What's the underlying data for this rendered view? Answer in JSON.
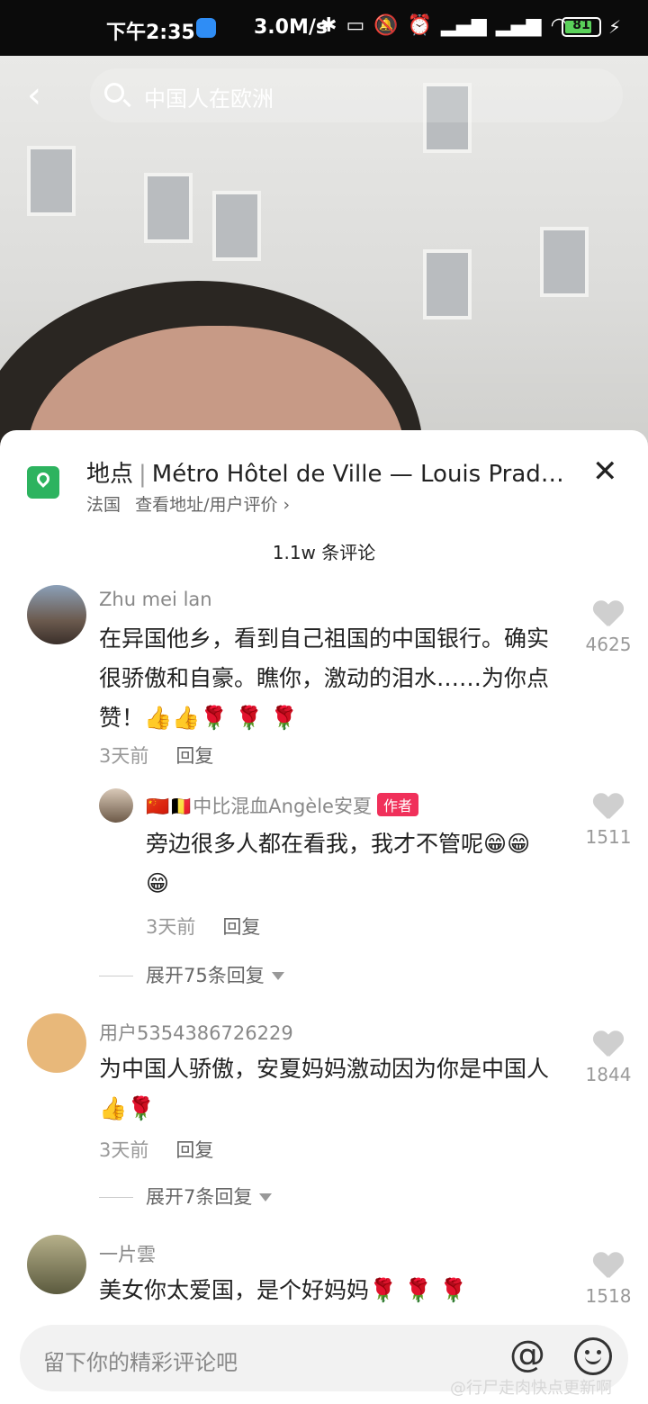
{
  "status_bar": {
    "time": "下午2:35",
    "speed": "3.0M/s",
    "battery": "81",
    "battery_level": 0.81
  },
  "search": {
    "placeholder": "中国人在欧洲"
  },
  "location": {
    "label": "地点",
    "name": "Métro Hôtel de Ville — Louis Prad…",
    "country": "法国",
    "link": "查看地址/用户评价"
  },
  "comments_header": {
    "count": "1.1w 条评论"
  },
  "comments": [
    {
      "author": "Zhu mei lan",
      "text": "在异国他乡，看到自己祖国的中国银行。确实很骄傲和自豪。瞧你，激动的泪水……为你点赞！👍👍🌹 🌹 🌹",
      "time": "3天前",
      "reply": "回复",
      "likes": "4625"
    },
    {
      "author": "🇨🇳🇧🇪中比混血Angèle安夏",
      "badge": "作者",
      "text": "旁边很多人都在看我，我才不管呢😁😁😁",
      "time": "3天前",
      "reply": "回复",
      "likes": "1511"
    },
    {
      "author": "用户5354386726229",
      "text": "为中国人骄傲，安夏妈妈激动因为你是中国人👍🌹",
      "time": "3天前",
      "reply": "回复",
      "likes": "1844"
    },
    {
      "author": "一片雲",
      "text": "美女你太爱国，是个好妈妈🌹 🌹 🌹",
      "likes": "1518"
    }
  ],
  "expand": [
    "展开75条回复",
    "展开7条回复"
  ],
  "input": {
    "placeholder": "留下你的精彩评论吧",
    "at": "@"
  },
  "watermark": "@行尸走肉快点更新啊"
}
